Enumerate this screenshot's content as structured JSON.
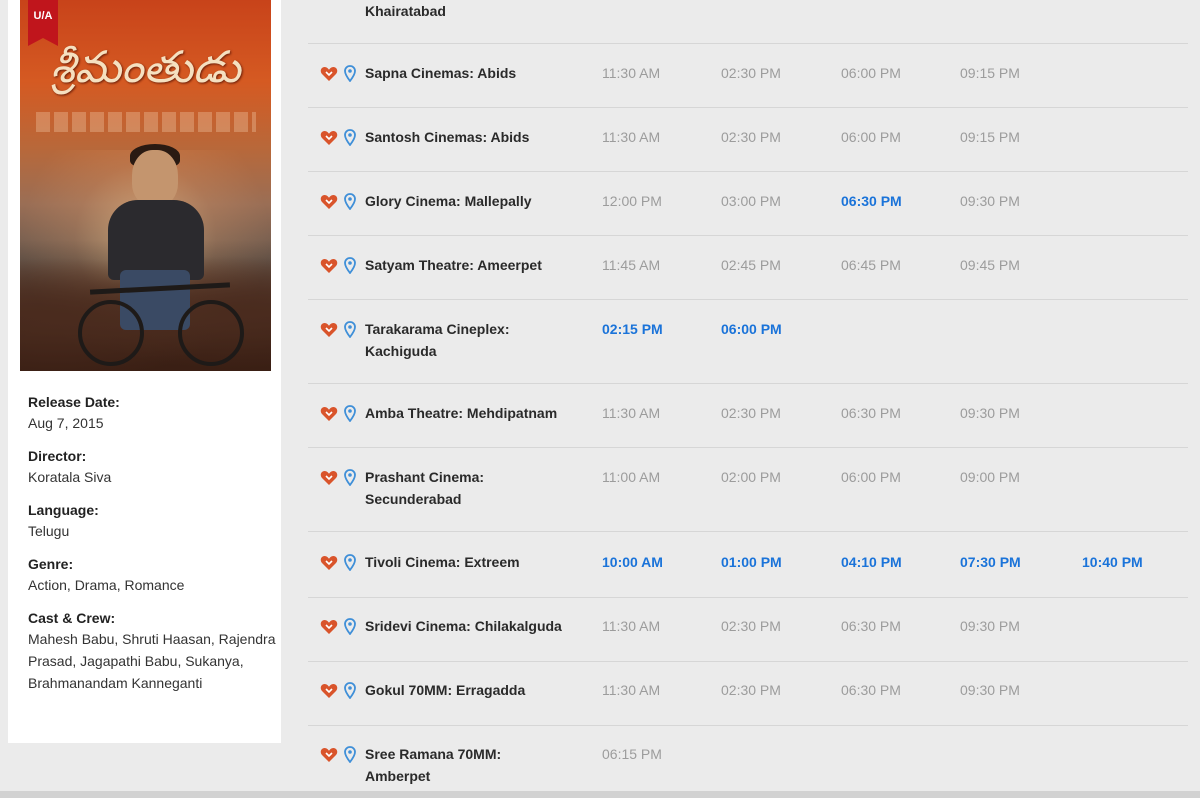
{
  "poster": {
    "rating_badge": "U/A",
    "title_script": "శ్రీమంతుడు"
  },
  "movie_info": [
    {
      "label": "Release Date:",
      "value": "Aug 7, 2015"
    },
    {
      "label": "Director:",
      "value": "Koratala Siva"
    },
    {
      "label": "Language:",
      "value": "Telugu"
    },
    {
      "label": "Genre:",
      "value": "Action, Drama, Romance"
    },
    {
      "label": "Cast & Crew:",
      "value": "Mahesh Babu, Shruti Haasan, Rajendra Prasad, Jagapathi Babu, Sukanya, Brahmanandam Kanneganti"
    }
  ],
  "theatres": [
    {
      "name_lines": [
        "Khairatabad"
      ],
      "times": []
    },
    {
      "name_lines": [
        "Sapna Cinemas: Abids"
      ],
      "times": [
        {
          "t": "11:30 AM",
          "available": false
        },
        {
          "t": "02:30 PM",
          "available": false
        },
        {
          "t": "06:00 PM",
          "available": false
        },
        {
          "t": "09:15 PM",
          "available": false
        }
      ]
    },
    {
      "name_lines": [
        "Santosh Cinemas: Abids"
      ],
      "times": [
        {
          "t": "11:30 AM",
          "available": false
        },
        {
          "t": "02:30 PM",
          "available": false
        },
        {
          "t": "06:00 PM",
          "available": false
        },
        {
          "t": "09:15 PM",
          "available": false
        }
      ]
    },
    {
      "name_lines": [
        "Glory Cinema: Mallepally"
      ],
      "times": [
        {
          "t": "12:00 PM",
          "available": false
        },
        {
          "t": "03:00 PM",
          "available": false
        },
        {
          "t": "06:30 PM",
          "available": true
        },
        {
          "t": "09:30 PM",
          "available": false
        }
      ]
    },
    {
      "name_lines": [
        "Satyam Theatre: Ameerpet"
      ],
      "times": [
        {
          "t": "11:45 AM",
          "available": false
        },
        {
          "t": "02:45 PM",
          "available": false
        },
        {
          "t": "06:45 PM",
          "available": false
        },
        {
          "t": "09:45 PM",
          "available": false
        }
      ]
    },
    {
      "name_lines": [
        "Tarakarama Cineplex:",
        "Kachiguda"
      ],
      "times": [
        {
          "t": "02:15 PM",
          "available": true
        },
        {
          "t": "06:00 PM",
          "available": true
        }
      ]
    },
    {
      "name_lines": [
        "Amba Theatre: Mehdipatnam"
      ],
      "times": [
        {
          "t": "11:30 AM",
          "available": false
        },
        {
          "t": "02:30 PM",
          "available": false
        },
        {
          "t": "06:30 PM",
          "available": false
        },
        {
          "t": "09:30 PM",
          "available": false
        }
      ]
    },
    {
      "name_lines": [
        "Prashant Cinema:",
        "Secunderabad"
      ],
      "times": [
        {
          "t": "11:00 AM",
          "available": false
        },
        {
          "t": "02:00 PM",
          "available": false
        },
        {
          "t": "06:00 PM",
          "available": false
        },
        {
          "t": "09:00 PM",
          "available": false
        }
      ]
    },
    {
      "name_lines": [
        "Tivoli Cinema: Extreem"
      ],
      "times": [
        {
          "t": "10:00 AM",
          "available": true
        },
        {
          "t": "01:00 PM",
          "available": true
        },
        {
          "t": "04:10 PM",
          "available": true
        },
        {
          "t": "07:30 PM",
          "available": true
        },
        {
          "t": "10:40 PM",
          "available": true
        }
      ]
    },
    {
      "name_lines": [
        "Sridevi Cinema: Chilakalguda"
      ],
      "times": [
        {
          "t": "11:30 AM",
          "available": false
        },
        {
          "t": "02:30 PM",
          "available": false
        },
        {
          "t": "06:30 PM",
          "available": false
        },
        {
          "t": "09:30 PM",
          "available": false
        }
      ]
    },
    {
      "name_lines": [
        "Gokul 70MM: Erragadda"
      ],
      "times": [
        {
          "t": "11:30 AM",
          "available": false
        },
        {
          "t": "02:30 PM",
          "available": false
        },
        {
          "t": "06:30 PM",
          "available": false
        },
        {
          "t": "09:30 PM",
          "available": false
        }
      ]
    },
    {
      "name_lines": [
        "Sree Ramana 70MM:",
        "Amberpet"
      ],
      "times": [
        {
          "t": "06:15 PM",
          "available": false
        }
      ]
    }
  ],
  "colors": {
    "available_time": "#1a73d9",
    "unavailable_time": "#9c9c9c",
    "heart_icon": "#d9542b",
    "pin_icon": "#3f8fd8"
  }
}
